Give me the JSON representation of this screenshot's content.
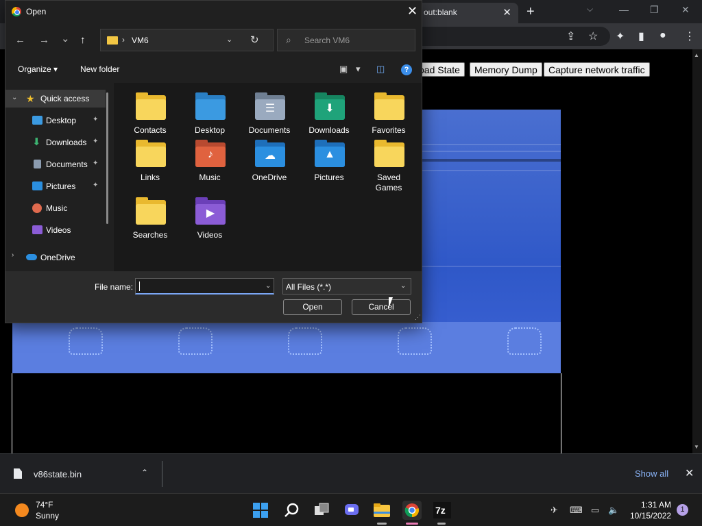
{
  "browser": {
    "tab_title": "out:blank",
    "tab_close": "✕",
    "new_tab": "+",
    "tab_search": "⌵",
    "win_minimize": "—",
    "win_restore": "❐",
    "win_close": "✕",
    "toolbar_icons": {
      "share": "⇪",
      "star": "☆",
      "extensions": "✦",
      "sidepanel": "▮",
      "profile": "●",
      "menu": "⋮"
    }
  },
  "page": {
    "buttons": [
      "oad State",
      "Memory Dump",
      "Capture network traffic"
    ]
  },
  "dialog": {
    "title": "Open",
    "close": "✕",
    "nav": {
      "back": "←",
      "forward": "→",
      "recent": "⌄",
      "up": "↑"
    },
    "address": {
      "separator": "›",
      "path": "VM6",
      "dropdown": "⌄",
      "refresh": "↻"
    },
    "search": {
      "icon": "⌕",
      "placeholder": "Search VM6"
    },
    "commands": {
      "organize": "Organize ▾",
      "new_folder": "New folder",
      "view": "▣",
      "view_drop": "▾",
      "preview": "◫",
      "help": "?"
    },
    "nav_pane": [
      {
        "label": "Quick access",
        "icon": "star-icon",
        "color": "#f2c12e",
        "pinned": false,
        "expanded": true,
        "selected": true
      },
      {
        "label": "Desktop",
        "icon": "desktop-icon",
        "color": "#3b9ae1",
        "pinned": true
      },
      {
        "label": "Downloads",
        "icon": "downloads-icon",
        "color": "#3cb371",
        "pinned": true
      },
      {
        "label": "Documents",
        "icon": "documents-icon",
        "color": "#8c9cb0",
        "pinned": true
      },
      {
        "label": "Pictures",
        "icon": "pictures-icon",
        "color": "#2b8fe0",
        "pinned": true
      },
      {
        "label": "Music",
        "icon": "music-icon",
        "color": "#e06a4e",
        "pinned": false
      },
      {
        "label": "Videos",
        "icon": "videos-icon",
        "color": "#8b5cd6",
        "pinned": false
      },
      {
        "label": "OneDrive",
        "icon": "onedrive-icon",
        "color": "#2b8fe0",
        "pinned": false,
        "collapsed": true
      }
    ],
    "pin_glyph": "📌",
    "tiles": [
      {
        "label": "Contacts",
        "icon": "folder-icon",
        "glyph": "",
        "color": "#e9b92f"
      },
      {
        "label": "Desktop",
        "icon": "desktop-folder-icon",
        "glyph": "",
        "color": "#3b9ae1"
      },
      {
        "label": "Documents",
        "icon": "documents-folder-icon",
        "glyph": "☰",
        "color": "#8c9cb0"
      },
      {
        "label": "Downloads",
        "icon": "downloads-folder-icon",
        "glyph": "⬇",
        "color": "#1fa37a"
      },
      {
        "label": "Favorites",
        "icon": "folder-icon",
        "glyph": "",
        "color": "#e9b92f"
      },
      {
        "label": "Links",
        "icon": "folder-icon",
        "glyph": "",
        "color": "#e9b92f"
      },
      {
        "label": "Music",
        "icon": "music-folder-icon",
        "glyph": "♪",
        "color": "#e0623f"
      },
      {
        "label": "OneDrive",
        "icon": "onedrive-folder-icon",
        "glyph": "☁",
        "color": "#2b8fe0"
      },
      {
        "label": "Pictures",
        "icon": "pictures-folder-icon",
        "glyph": "▲",
        "color": "#2b8fe0"
      },
      {
        "label": "Saved Games",
        "icon": "folder-icon",
        "glyph": "",
        "color": "#e9b92f"
      },
      {
        "label": "Searches",
        "icon": "folder-icon",
        "glyph": "",
        "color": "#e9b92f"
      },
      {
        "label": "Videos",
        "icon": "videos-folder-icon",
        "glyph": "▶",
        "color": "#8b5cd6"
      }
    ],
    "file_name_label": "File name:",
    "file_name_value": "",
    "file_name_drop": "⌄",
    "filter": "All Files (*.*)",
    "filter_drop": "⌄",
    "open_button": "Open",
    "cancel_button": "Cancel",
    "grip": "⋰"
  },
  "download_bar": {
    "file_name": "v86state.bin",
    "chevron": "⌃",
    "show_all": "Show all",
    "close": "✕"
  },
  "taskbar": {
    "temperature": "74°F",
    "condition": "Sunny",
    "time": "1:31 AM",
    "date": "10/15/2022",
    "notifications": "1",
    "sys_icons": {
      "wifi_off": "✈",
      "keyboard": "⌨",
      "network": "▭",
      "volume": "🔈"
    }
  }
}
